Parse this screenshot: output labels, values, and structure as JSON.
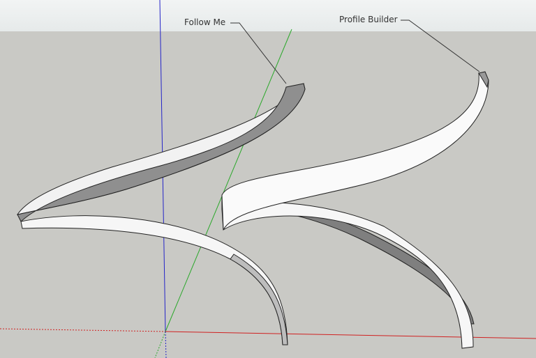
{
  "labels": {
    "follow_me": "Follow Me",
    "profile_builder": "Profile Builder"
  },
  "colors": {
    "sky": "#e8ecec",
    "ground": "#c9c9c5",
    "x_axis": "#d02020",
    "y_axis": "#20a020",
    "z_axis": "#2020c0"
  }
}
